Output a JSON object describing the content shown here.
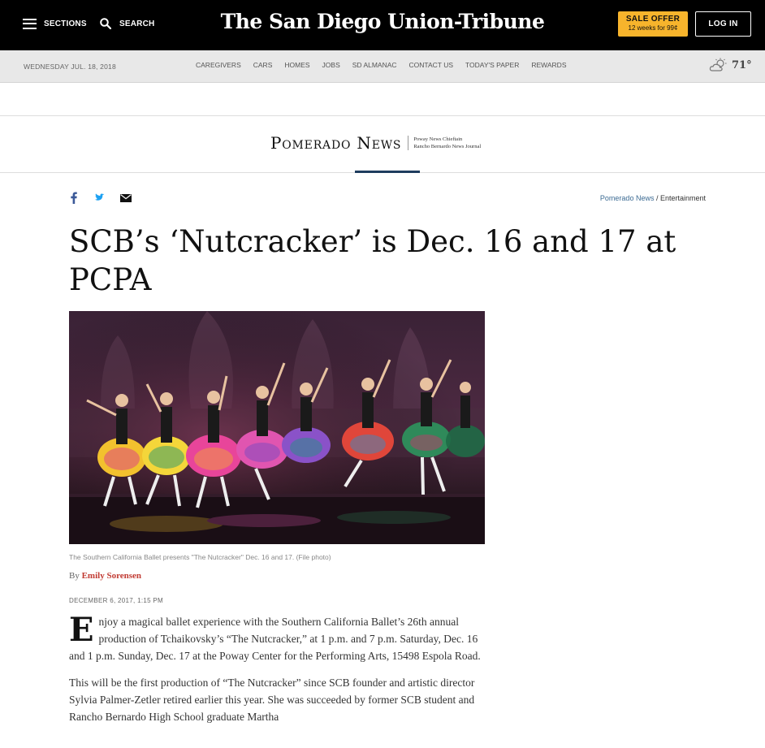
{
  "topbar": {
    "sections_label": "SECTIONS",
    "search_label": "SEARCH",
    "masthead": "The San Diego Union-Tribune",
    "sale_title": "SALE OFFER",
    "sale_sub": "12 weeks for 99¢",
    "login_label": "LOG IN"
  },
  "navbar": {
    "date": "WEDNESDAY JUL. 18, 2018",
    "links": [
      "CAREGIVERS",
      "CARS",
      "HOMES",
      "JOBS",
      "SD ALMANAC",
      "CONTACT US",
      "TODAY'S PAPER",
      "REWARDS"
    ],
    "weather_icon": "partly-cloudy-icon",
    "temperature": "71°"
  },
  "section_header": {
    "title": "Pomerado News",
    "sub_line1": "Poway News Chieftain",
    "sub_line2": "Rancho Bernardo News Journal"
  },
  "social": {
    "icons": [
      "facebook-icon",
      "twitter-icon",
      "email-icon"
    ]
  },
  "breadcrumb": {
    "section": "Pomerado News",
    "separator": " / ",
    "subsection": "Entertainment"
  },
  "article": {
    "headline": "SCB’s ‘Nutcracker’ is Dec. 16 and 17 at PCPA",
    "caption": "The Southern California Ballet presents \"The Nutcracker\" Dec. 16 and 17. (File photo)",
    "by_prefix": "By ",
    "author": "Emily Sorensen",
    "date": "DECEMBER 6, 2017, 1:15 PM",
    "dropcap": "E",
    "paragraph1": "njoy a magical ballet experience with the Southern California Ballet’s 26th annual production of Tchaikovsky’s “The Nutcracker,” at 1 p.m. and 7 p.m. Saturday, Dec. 16 and 1 p.m. Sunday, Dec. 17 at the Poway Center for the Performing Arts, 15498 Espola Road.",
    "paragraph2": "This will be the first production of “The Nutcracker” since SCB founder and artistic director Sylvia Palmer-Zetler retired earlier this year. She was succeeded by former SCB student and Rancho Bernardo High School graduate Martha"
  },
  "colors": {
    "topbar_bg": "#000000",
    "sale_bg": "#f7b42c",
    "author": "#c13a32",
    "link": "#3c6b93",
    "section_underline": "#1e3c5e"
  }
}
